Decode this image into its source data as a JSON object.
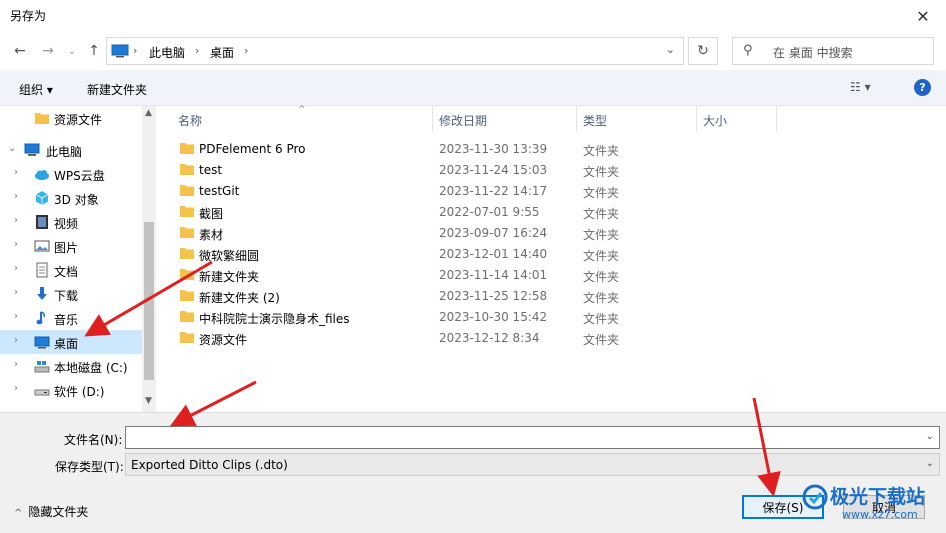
{
  "window": {
    "title": "另存为"
  },
  "address": {
    "segments": [
      "此电脑",
      "桌面"
    ]
  },
  "search": {
    "placeholder": "在 桌面 中搜索"
  },
  "toolbar": {
    "organize": "组织 ▾",
    "new_folder": "新建文件夹"
  },
  "sidebar": {
    "items": [
      {
        "label": "资源文件",
        "icon": "folder-icon"
      },
      {
        "label": "此电脑",
        "icon": "computer-icon"
      },
      {
        "label": "WPS云盘",
        "icon": "cloud-icon"
      },
      {
        "label": "3D 对象",
        "icon": "3d-objects-icon"
      },
      {
        "label": "视频",
        "icon": "video-icon"
      },
      {
        "label": "图片",
        "icon": "pictures-icon"
      },
      {
        "label": "文档",
        "icon": "documents-icon"
      },
      {
        "label": "下载",
        "icon": "download-icon"
      },
      {
        "label": "音乐",
        "icon": "music-icon"
      },
      {
        "label": "桌面",
        "icon": "desktop-icon",
        "selected": true
      },
      {
        "label": "本地磁盘 (C:)",
        "icon": "local-disk-icon"
      },
      {
        "label": "软件 (D:)",
        "icon": "drive-icon"
      }
    ]
  },
  "columns": {
    "name": "名称",
    "date": "修改日期",
    "type": "类型",
    "size": "大小"
  },
  "files": [
    {
      "name": "PDFelement 6 Pro",
      "date": "2023-11-30 13:39",
      "type": "文件夹"
    },
    {
      "name": "test",
      "date": "2023-11-24 15:03",
      "type": "文件夹"
    },
    {
      "name": "testGit",
      "date": "2023-11-22 14:17",
      "type": "文件夹"
    },
    {
      "name": "截图",
      "date": "2022-07-01 9:55",
      "type": "文件夹"
    },
    {
      "name": "素材",
      "date": "2023-09-07 16:24",
      "type": "文件夹"
    },
    {
      "name": "微软繁细圆",
      "date": "2023-12-01 14:40",
      "type": "文件夹"
    },
    {
      "name": "新建文件夹",
      "date": "2023-11-14 14:01",
      "type": "文件夹"
    },
    {
      "name": "新建文件夹 (2)",
      "date": "2023-11-25 12:58",
      "type": "文件夹"
    },
    {
      "name": "中科院院士演示隐身术_files",
      "date": "2023-10-30 15:42",
      "type": "文件夹"
    },
    {
      "name": "资源文件",
      "date": "2023-12-12 8:34",
      "type": "文件夹"
    }
  ],
  "form": {
    "filename_label": "文件名(N):",
    "filename_value": "",
    "type_label": "保存类型(T):",
    "type_value": "Exported Ditto Clips (.dto)"
  },
  "footer": {
    "hide_folders": "隐藏文件夹",
    "save": "保存(S)",
    "cancel": "取消"
  },
  "watermark": {
    "line1": "极光下载站",
    "line2": "www.xz7.com"
  },
  "colors": {
    "accent": "#0078d7",
    "selection": "#cce8ff",
    "annotation": "#e02020",
    "folder": "#f5c34a"
  }
}
